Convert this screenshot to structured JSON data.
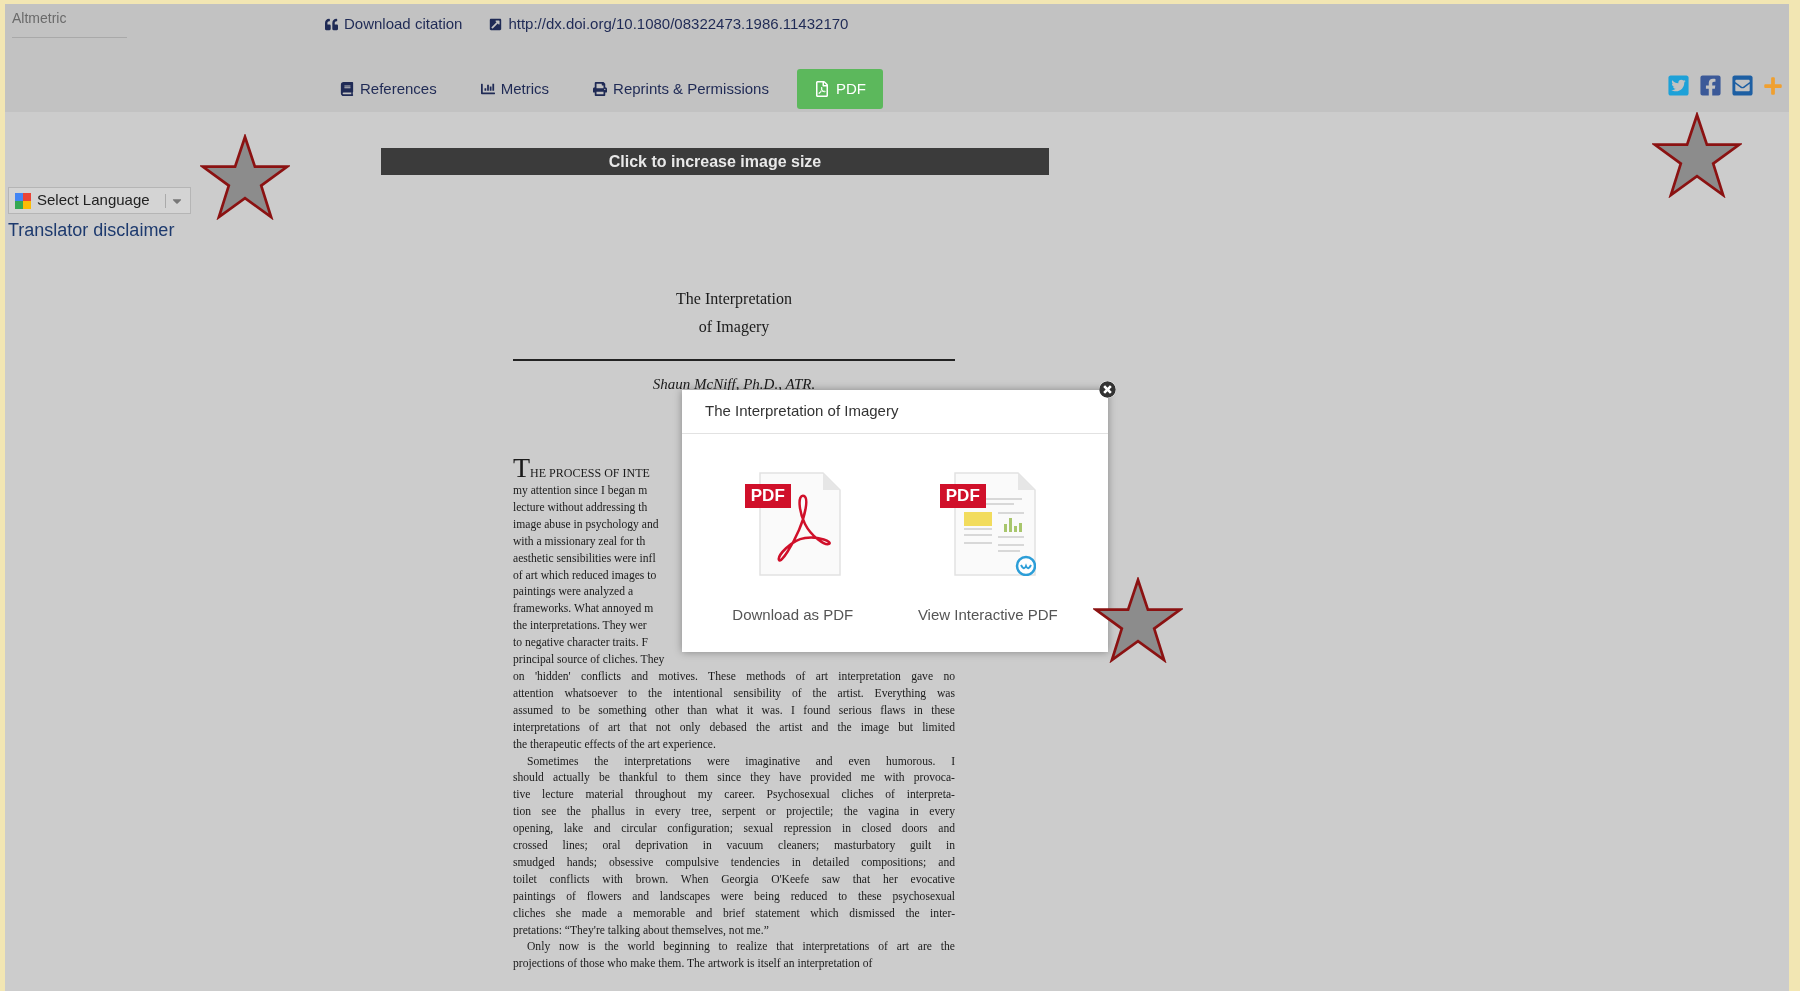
{
  "header": {
    "altmetric": "Altmetric",
    "links": [
      {
        "kind": "citation",
        "label": "Download citation"
      },
      {
        "kind": "doi",
        "label": "http://dx.doi.org/10.1080/08322473.1986.11432170"
      }
    ],
    "tabs": [
      {
        "kind": "references",
        "label": "References"
      },
      {
        "kind": "metrics",
        "label": "Metrics"
      },
      {
        "kind": "reprints",
        "label": "Reprints & Permissions"
      },
      {
        "kind": "pdf",
        "label": "PDF"
      }
    ]
  },
  "translator": {
    "select": "Select Language",
    "disclaimer": "Translator disclaimer"
  },
  "figure": {
    "banner": "Click to increase image size",
    "document": {
      "title_lines": [
        "The Interpretation",
        "of Imagery"
      ],
      "author": "Shaun McNiff, Ph.D., ATR.",
      "paragraphs": [
        {
          "drop_cap": "T",
          "lines": [
            {
              "text": "HE PROCESS OF INTE",
              "cut": true
            },
            {
              "text": "my attention since I began m",
              "cut": true
            },
            {
              "text": "lecture without addressing th",
              "cut": true
            },
            {
              "text": "image abuse in psychology and",
              "cut": true
            },
            {
              "text": "with a missionary zeal for th",
              "cut": true
            },
            {
              "text": "aesthetic sensibilities were infl",
              "cut": true
            },
            {
              "text": "of art which reduced images to",
              "cut": true
            },
            {
              "text": "paintings were analyzed a",
              "cut": true
            },
            {
              "text": "frameworks. What annoyed m",
              "cut": true
            },
            {
              "text": "the interpretations. They wer",
              "cut": true
            },
            {
              "text": "to negative character traits. F",
              "cut": true
            },
            {
              "text": "principal source of cliches. They",
              "cut": true
            },
            {
              "text": "on 'hidden' conflicts and motives. These methods of art interpretation gave no",
              "cut": false
            },
            {
              "text": "attention whatsoever to the intentional sensibility of the artist. Everything was",
              "cut": false
            },
            {
              "text": "assumed to be something other than what it was. I found serious flaws in these",
              "cut": false
            },
            {
              "text": "interpretations of art that not only debased the artist and the image but limited",
              "cut": false
            },
            {
              "text": "the therapeutic effects of the art experience.",
              "cut": false
            }
          ]
        },
        {
          "lines": [
            {
              "text": "Sometimes the interpretations were imaginative and even humorous. I",
              "cut": false
            },
            {
              "text": "should actually be thankful to them since they have provided me with provoca-",
              "cut": false
            },
            {
              "text": "tive lecture material throughout my career. Psychosexual cliches of interpreta-",
              "cut": false
            },
            {
              "text": "tion see the phallus in every tree, serpent or projectile; the vagina in every",
              "cut": false
            },
            {
              "text": "opening, lake and circular configuration; sexual repression in closed doors and",
              "cut": false
            },
            {
              "text": "crossed lines; oral deprivation in vacuum cleaners; masturbatory guilt in",
              "cut": false
            },
            {
              "text": "smudged hands; obsessive compulsive tendencies in detailed compositions; and",
              "cut": false
            },
            {
              "text": "toilet conflicts with brown. When Georgia O'Keefe saw that her evocative",
              "cut": false
            },
            {
              "text": "paintings of flowers and landscapes were being reduced to these psychosexual",
              "cut": false
            },
            {
              "text": "cliches she made a memorable and brief statement which dismissed the inter-",
              "cut": false
            },
            {
              "text": "pretations: “They're talking about themselves, not me.”",
              "cut": false
            }
          ]
        },
        {
          "lines": [
            {
              "text": "Only now is the world beginning to realize that interpretations of art are the",
              "cut": false
            },
            {
              "text": "projections of those who make them. The artwork is itself an interpretation of",
              "cut": false
            }
          ]
        }
      ]
    }
  },
  "modal": {
    "title": "The Interpretation of Imagery",
    "options": [
      {
        "kind": "download",
        "badge": "PDF",
        "label": "Download as PDF"
      },
      {
        "kind": "interactive",
        "badge": "PDF",
        "label": "View Interactive PDF"
      }
    ]
  }
}
